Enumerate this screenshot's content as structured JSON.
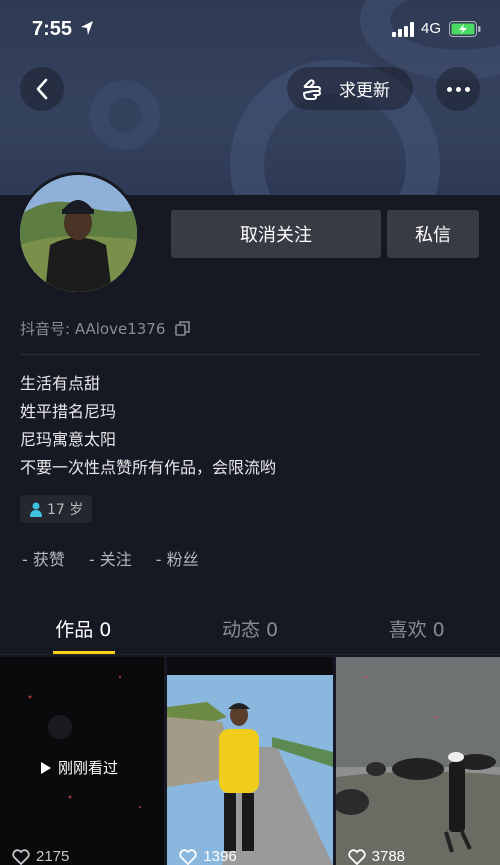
{
  "status_bar": {
    "time": "7:55",
    "network": "4G"
  },
  "header": {
    "update_label": "求更新",
    "back_icon": "chevron-left-icon",
    "more_icon": "more-dots-icon"
  },
  "profile": {
    "unfollow_label": "取消关注",
    "message_label": "私信",
    "douyin_id": "抖音号: AAlove1376",
    "bio_lines": [
      "生活有点甜",
      "姓平措名尼玛",
      "尼玛寓意太阳",
      "不要一次性点赞所有作品，会限流哟"
    ],
    "age": "17 岁",
    "stats": {
      "likes": "- 获赞",
      "following": "- 关注",
      "followers": "- 粉丝"
    }
  },
  "tabs": [
    {
      "label": "作品 0",
      "active": true
    },
    {
      "label": "动态 0",
      "active": false
    },
    {
      "label": "喜欢 0",
      "active": false
    }
  ],
  "videos": [
    {
      "overlay": "刚刚看过",
      "likes": "2175"
    },
    {
      "likes": "1396"
    },
    {
      "likes": "3788"
    }
  ],
  "colors": {
    "accent": "#face15",
    "background": "#161823",
    "button": "#393b44"
  }
}
